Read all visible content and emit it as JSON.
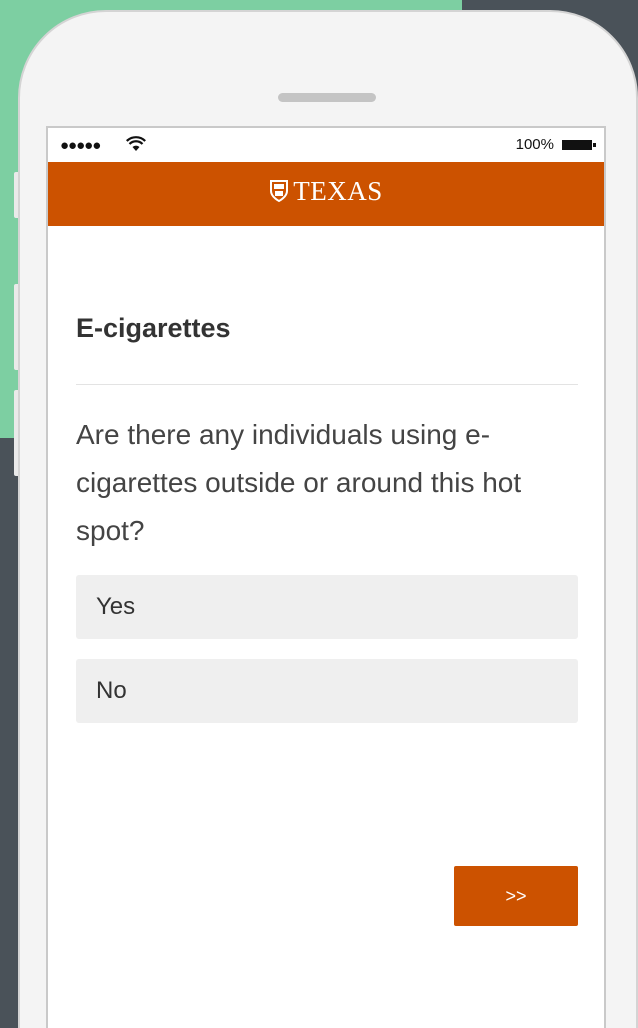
{
  "status_bar": {
    "signal": "●●●●●",
    "wifi_icon": "wifi-icon",
    "battery_percent": "100%",
    "battery_icon": "battery-icon"
  },
  "header": {
    "brand": "TEXAS",
    "logo_icon": "shield-icon",
    "color": "#cc5200"
  },
  "survey": {
    "title": "E-cigarettes",
    "question": "Are there any individuals using e-cigarettes outside or around this hot spot?",
    "options": [
      {
        "label": "Yes"
      },
      {
        "label": "No"
      }
    ],
    "next_label": ">>"
  },
  "colors": {
    "accent": "#cc5200",
    "background_green": "#7dcfa2",
    "background_slate": "#4a5259"
  }
}
